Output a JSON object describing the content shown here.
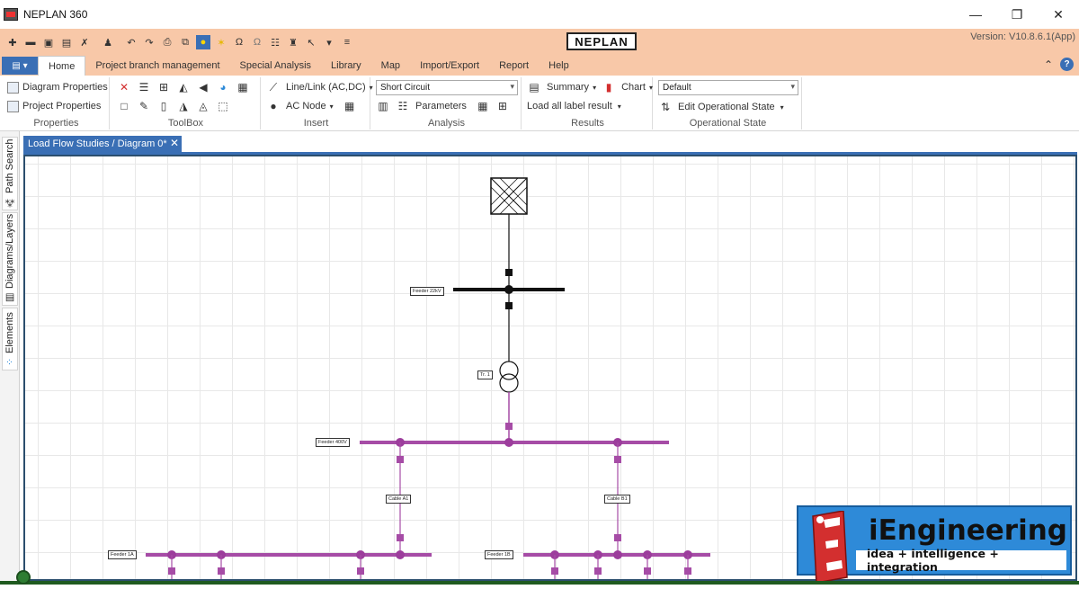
{
  "window": {
    "title": "NEPLAN 360",
    "minimize": "—",
    "restore": "❐",
    "close": "✕"
  },
  "header": {
    "logo_text": "NEPLAN",
    "version": "Version: V10.8.6.1(App)"
  },
  "tabs": [
    "Home",
    "Project branch management",
    "Special Analysis",
    "Library",
    "Map",
    "Import/Export",
    "Report",
    "Help"
  ],
  "ribbon": {
    "properties": {
      "label": "Properties",
      "diagram_props": "Diagram Properties",
      "project_props": "Project Properties"
    },
    "toolbox": {
      "label": "ToolBox"
    },
    "insert": {
      "label": "Insert",
      "line_link": "Line/Link (AC,DC)",
      "ac_node": "AC Node"
    },
    "analysis": {
      "label": "Analysis",
      "selected": "Short Circuit",
      "parameters": "Parameters"
    },
    "results": {
      "label": "Results",
      "summary": "Summary",
      "chart": "Chart",
      "load_all": "Load all label result"
    },
    "operational": {
      "label": "Operational State",
      "selected": "Default",
      "edit": "Edit Operational State"
    }
  },
  "sidebar": {
    "path_search": "Path Search",
    "diagrams_layers": "Diagrams/Layers",
    "elements": "Elements"
  },
  "document": {
    "tab_title": "Load Flow Studies / Diagram 0*",
    "close": "✕"
  },
  "diagram": {
    "labels": {
      "feeder_22kv": "Feeder 22kV",
      "tr1": "Tr. 1",
      "feeder_400v": "Feeder 400V",
      "cable_a1": "Cable A1",
      "cable_b1": "Cable B1",
      "feeder_1a": "Feeder 1A",
      "feeder_1b": "Feeder 1B"
    },
    "colors": {
      "mv": "#111111",
      "lv": "#a64ca6",
      "node": "#9c3d9c"
    }
  },
  "brand": {
    "title": "iEngineering",
    "tagline": "idea + intelligence + integration",
    "colors": {
      "bg": "#2e8ad8",
      "badge": "#d32f2f"
    }
  }
}
